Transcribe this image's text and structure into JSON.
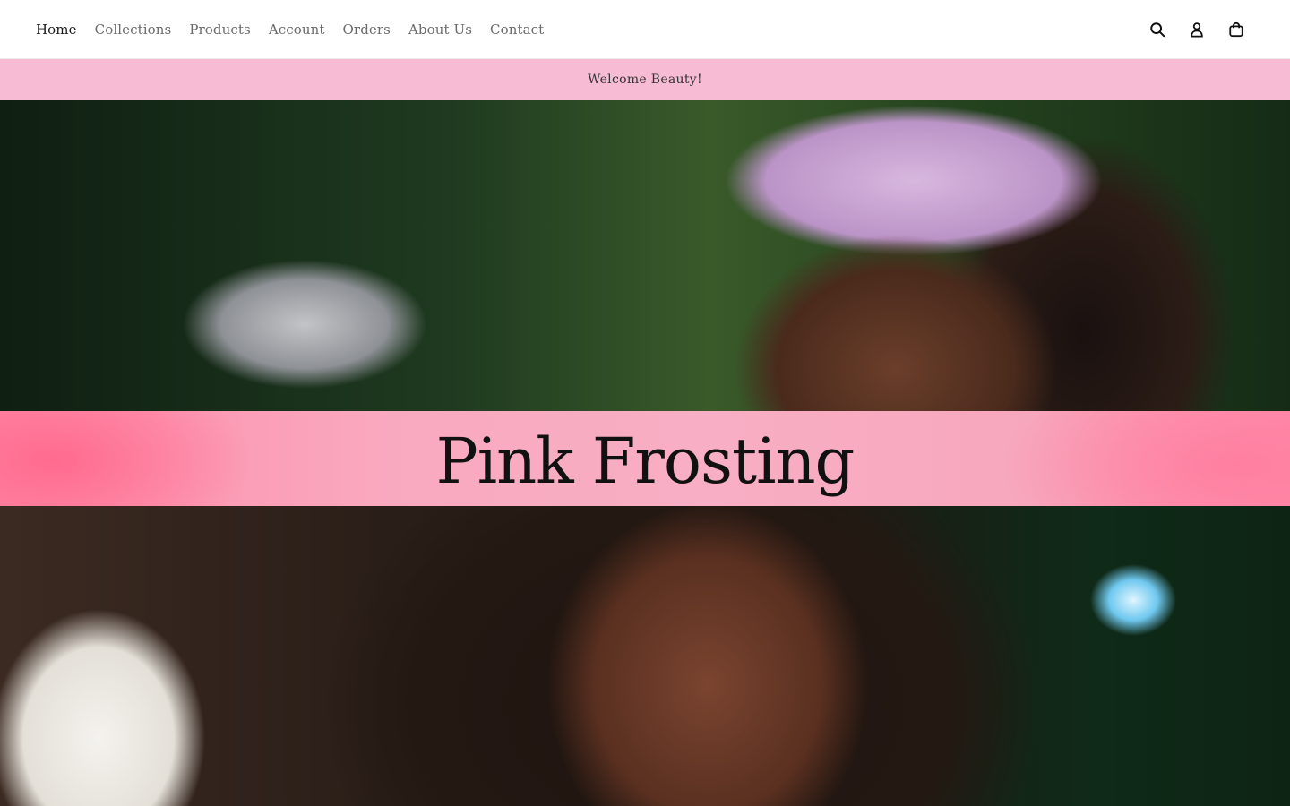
{
  "header": {
    "nav": [
      {
        "label": "Home",
        "active": true
      },
      {
        "label": "Collections",
        "active": false
      },
      {
        "label": "Products",
        "active": false
      },
      {
        "label": "Account",
        "active": false
      },
      {
        "label": "Orders",
        "active": false
      },
      {
        "label": "About Us",
        "active": false
      },
      {
        "label": "Contact",
        "active": false
      }
    ],
    "icons": [
      "search-icon",
      "account-icon",
      "cart-icon"
    ]
  },
  "announcement": {
    "text": "Welcome Beauty!",
    "background": "#f7bcd3"
  },
  "hero": {
    "title": "Pink Frosting",
    "band_color": "#f8aec4",
    "images": [
      "model-with-camcorder-photo",
      "model-with-lip-gloss-photo"
    ]
  }
}
